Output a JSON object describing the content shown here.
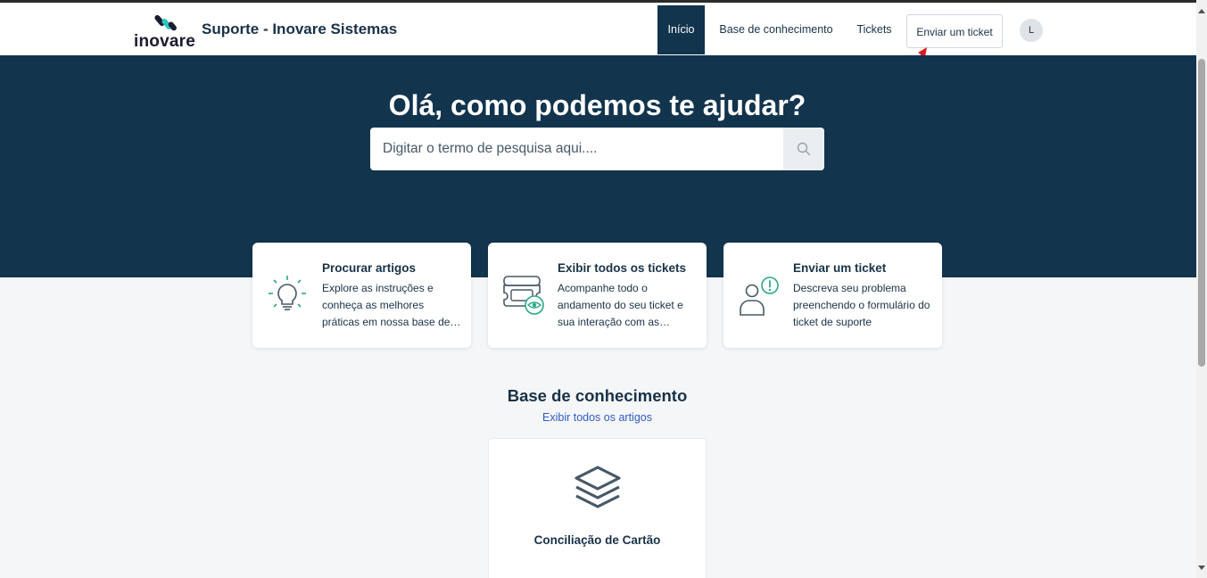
{
  "header": {
    "logo_text": "inovare",
    "site_title": "Suporte - Inovare Sistemas",
    "nav": [
      {
        "label": "Início",
        "active": true
      },
      {
        "label": "Base de conhecimento",
        "active": false
      },
      {
        "label": "Tickets",
        "active": false
      }
    ],
    "submit_ticket_label": "Enviar um ticket",
    "avatar_initial": "L"
  },
  "hero": {
    "title": "Olá, como podemos te ajudar?",
    "search_placeholder": "Digitar o termo de pesquisa aqui...."
  },
  "cards": [
    {
      "title": "Procurar artigos",
      "description": "Explore as instruções e conheça as melhores práticas em nossa base de conhecimento",
      "icon": "lightbulb-icon"
    },
    {
      "title": "Exibir todos os tickets",
      "description": "Acompanhe todo o andamento do seu ticket e sua interação com as equipes de suporte",
      "icon": "tickets-eye-icon"
    },
    {
      "title": "Enviar um ticket",
      "description": "Descreva seu problema preenchendo o formulário do ticket de suporte",
      "icon": "user-alert-icon"
    }
  ],
  "knowledge_base": {
    "title": "Base de conhecimento",
    "view_all_label": "Exibir todos os artigos",
    "categories": [
      {
        "title": "Conciliação de Cartão",
        "icon": "layers-icon"
      }
    ]
  },
  "colors": {
    "brand_dark": "#12344d",
    "accent_green": "#2aa88a",
    "link_blue": "#2c5cc5",
    "annotation_red": "#e01b1b"
  }
}
